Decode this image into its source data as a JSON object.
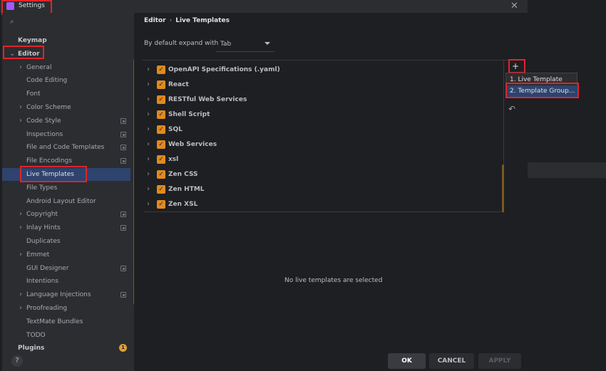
{
  "window": {
    "title": "Settings"
  },
  "search": {
    "placeholder": ""
  },
  "sidebar": {
    "items": [
      {
        "label": "Keymap",
        "level": 0,
        "bold": true
      },
      {
        "label": "Editor",
        "level": 0,
        "bold": true,
        "expanded": true
      },
      {
        "label": "General",
        "level": 1,
        "chevron": true
      },
      {
        "label": "Code Editing",
        "level": 1
      },
      {
        "label": "Font",
        "level": 1
      },
      {
        "label": "Color Scheme",
        "level": 1,
        "chevron": true
      },
      {
        "label": "Code Style",
        "level": 1,
        "chevron": true,
        "project_icon": true
      },
      {
        "label": "Inspections",
        "level": 1,
        "project_icon": true
      },
      {
        "label": "File and Code Templates",
        "level": 1,
        "project_icon": true
      },
      {
        "label": "File Encodings",
        "level": 1,
        "project_icon": true
      },
      {
        "label": "Live Templates",
        "level": 1,
        "selected": true
      },
      {
        "label": "File Types",
        "level": 1
      },
      {
        "label": "Android Layout Editor",
        "level": 1
      },
      {
        "label": "Copyright",
        "level": 1,
        "chevron": true,
        "project_icon": true
      },
      {
        "label": "Inlay Hints",
        "level": 1,
        "chevron": true,
        "project_icon": true
      },
      {
        "label": "Duplicates",
        "level": 1
      },
      {
        "label": "Emmet",
        "level": 1,
        "chevron": true
      },
      {
        "label": "GUI Designer",
        "level": 1,
        "project_icon": true
      },
      {
        "label": "Intentions",
        "level": 1
      },
      {
        "label": "Language Injections",
        "level": 1,
        "chevron": true,
        "project_icon": true
      },
      {
        "label": "Proofreading",
        "level": 1,
        "chevron": true
      },
      {
        "label": "TextMate Bundles",
        "level": 1
      },
      {
        "label": "TODO",
        "level": 1
      },
      {
        "label": "Plugins",
        "level": 0,
        "bold": true,
        "badge": "1"
      }
    ]
  },
  "breadcrumb": {
    "parent": "Editor",
    "separator": "›",
    "current": "Live Templates"
  },
  "expand": {
    "label": "By default expand with",
    "value": "Tab"
  },
  "template_groups": [
    {
      "name": "OpenAPI Specifications (.yaml)",
      "checked": true
    },
    {
      "name": "React",
      "checked": true
    },
    {
      "name": "RESTful Web Services",
      "checked": true
    },
    {
      "name": "Shell Script",
      "checked": true
    },
    {
      "name": "SQL",
      "checked": true
    },
    {
      "name": "Web Services",
      "checked": true
    },
    {
      "name": "xsl",
      "checked": true
    },
    {
      "name": "Zen CSS",
      "checked": true
    },
    {
      "name": "Zen HTML",
      "checked": true
    },
    {
      "name": "Zen XSL",
      "checked": true
    }
  ],
  "toolbar": {
    "add": "+",
    "undo": "↶"
  },
  "add_menu": {
    "items": [
      {
        "label": "1. Live Template"
      },
      {
        "label": "2. Template Group..."
      }
    ]
  },
  "empty_message": "No live templates are selected",
  "footer": {
    "ok": "OK",
    "cancel": "CANCEL",
    "apply": "APPLY",
    "help": "?"
  },
  "colors": {
    "accent_orange": "#e08a1e",
    "selection": "#2e436e",
    "highlight_red": "#e0242a"
  }
}
